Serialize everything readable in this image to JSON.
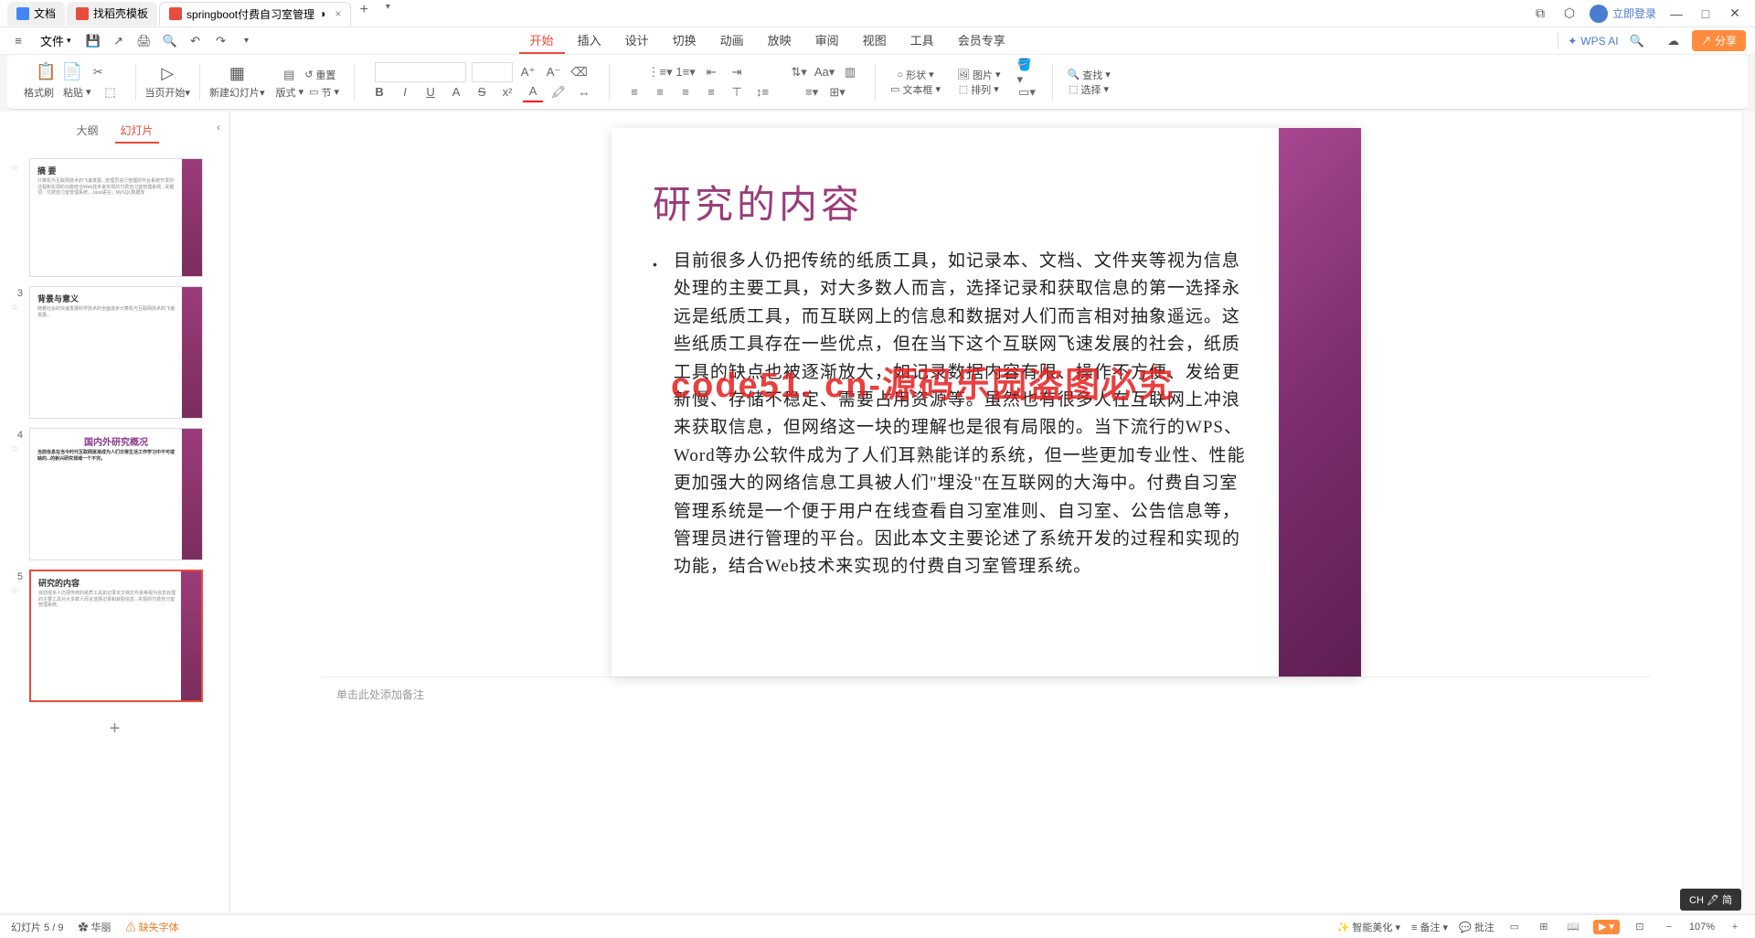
{
  "tabs": {
    "t1": "文档",
    "t2": "找稻壳模板",
    "t3": "springboot付费自习室管理",
    "add": "+"
  },
  "title_right": {
    "login": "立即登录"
  },
  "quickbar": {
    "file": "文件"
  },
  "menu": {
    "start": "开始",
    "insert": "插入",
    "design": "设计",
    "transition": "切换",
    "animation": "动画",
    "slideshow": "放映",
    "review": "审阅",
    "view": "视图",
    "tools": "工具",
    "member": "会员专享"
  },
  "menu_right": {
    "wpsai": "WPS AI"
  },
  "ribbon": {
    "format_painter": "格式刷",
    "paste": "粘贴",
    "start_from": "当页开始",
    "new_slide": "新建幻灯片",
    "layout": "版式",
    "section": "节",
    "reset": "重置",
    "shape": "形状",
    "image": "图片",
    "textbox": "文本框",
    "arrange": "排列",
    "find": "查找",
    "select": "选择"
  },
  "sidebar": {
    "outline": "大纲",
    "slides": "幻灯片",
    "thumbs": [
      {
        "idx": "",
        "title": "摘 要"
      },
      {
        "idx": "3",
        "title": "背景与意义"
      },
      {
        "idx": "4",
        "title": "国内外研究概况"
      },
      {
        "idx": "5",
        "title": "研究的内容"
      }
    ]
  },
  "slide": {
    "title": "研究的内容",
    "body": "目前很多人仍把传统的纸质工具，如记录本、文档、文件夹等视为信息处理的主要工具，对大多数人而言，选择记录和获取信息的第一选择永远是纸质工具，而互联网上的信息和数据对人们而言相对抽象遥远。这些纸质工具存在一些优点，但在当下这个互联网飞速发展的社会，纸质工具的缺点也被逐渐放大，如记录数据内容有限、操作不方便、发给更新慢、存储不稳定、需要占用资源等。虽然也有很多人在互联网上冲浪来获取信息，但网络这一块的理解也是很有局限的。当下流行的WPS、Word等办公软件成为了人们耳熟能详的系统，但一些更加专业性、性能更加强大的网络信息工具被人们\"埋没\"在互联网的大海中。付费自习室管理系统是一个便于用户在线查看自习室准则、自习室、公告信息等，管理员进行管理的平台。因此本文主要论述了系统开发的过程和实现的功能，结合Web技术来实现的付费自习室管理系统。",
    "watermark": "code51. cn-源码乐园盗图必究",
    "notes_placeholder": "单击此处添加备注"
  },
  "status": {
    "slide_counter": "幻灯片 5 / 9",
    "theme": "华丽",
    "missing_font": "缺失字体",
    "beautify": "智能美化",
    "notes": "备注",
    "comments": "批注",
    "zoom": "107%"
  },
  "ime": "CH 🖊 简",
  "share": "分享"
}
